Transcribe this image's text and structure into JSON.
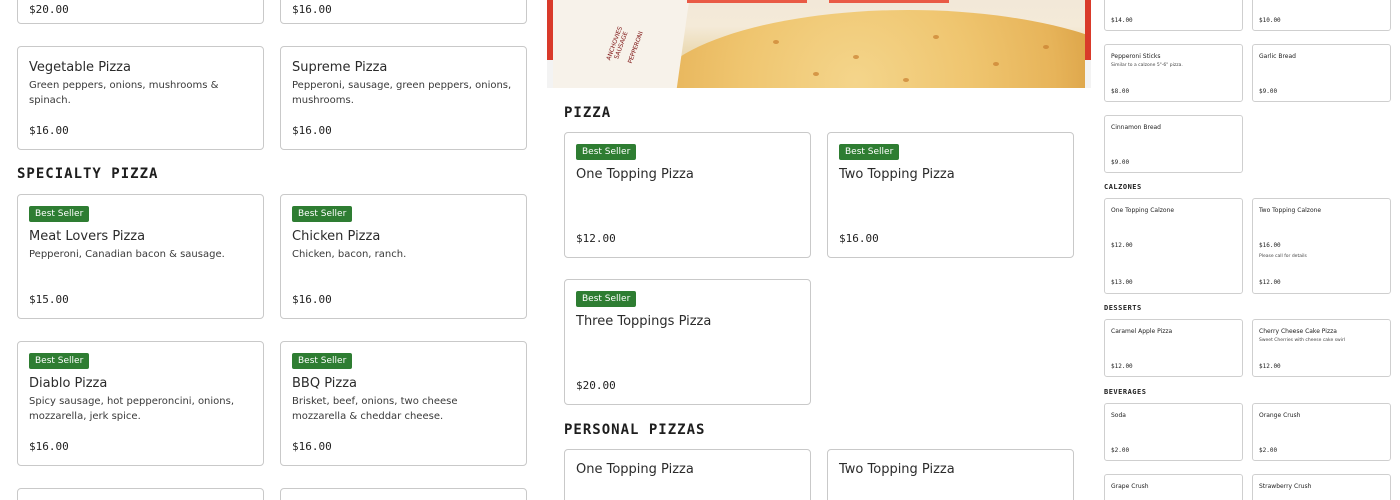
{
  "left": {
    "top_prices": [
      "$20.00",
      "$16.00"
    ],
    "row1": [
      {
        "name": "Vegetable Pizza",
        "desc": "Green peppers, onions, mushrooms & spinach.",
        "price": "$16.00"
      },
      {
        "name": "Supreme Pizza",
        "desc": "Pepperoni, sausage, green peppers, onions, mushrooms.",
        "price": "$16.00"
      }
    ],
    "specialty_title": "SPECIALTY PIZZA",
    "specialty": [
      {
        "badge": "Best Seller",
        "name": "Meat Lovers Pizza",
        "desc": "Pepperoni, Canadian bacon & sausage.",
        "price": "$15.00"
      },
      {
        "badge": "Best Seller",
        "name": "Chicken Pizza",
        "desc": "Chicken, bacon, ranch.",
        "price": "$16.00"
      },
      {
        "badge": "Best Seller",
        "name": "Diablo Pizza",
        "desc": "Spicy sausage, hot pepperoncini, onions, mozzarella, jerk spice.",
        "price": "$16.00"
      },
      {
        "badge": "Best Seller",
        "name": "BBQ Pizza",
        "desc": "Brisket, beef, onions, two cheese mozzarella & cheddar cheese.",
        "price": "$16.00"
      }
    ]
  },
  "hero": {
    "box_text": [
      "ANCHOVIES",
      "SAUSAGE",
      "PEPPERONI"
    ]
  },
  "middle": {
    "pizza_title": "PIZZA",
    "pizza": [
      {
        "badge": "Best Seller",
        "name": "One Topping Pizza",
        "price": "$12.00"
      },
      {
        "badge": "Best Seller",
        "name": "Two Topping Pizza",
        "price": "$16.00"
      },
      {
        "badge": "Best Seller",
        "name": "Three Toppings Pizza",
        "price": "$20.00"
      }
    ],
    "personal_title": "PERSONAL PIZZAS",
    "personal": [
      {
        "name": "One Topping Pizza"
      },
      {
        "name": "Two Topping Pizza"
      }
    ]
  },
  "right": {
    "top_prices": [
      "$14.00",
      "$10.00"
    ],
    "sides": [
      {
        "name": "Pepperoni Sticks",
        "desc": "Similar to a calzone 5\"-6\" pizza.",
        "price": "$8.00"
      },
      {
        "name": "Garlic Bread",
        "desc": "",
        "price": "$9.00"
      },
      {
        "name": "Cinnamon Bread",
        "desc": "",
        "price": "$9.00"
      }
    ],
    "calzones_title": "CALZONES",
    "calzones": [
      {
        "name": "One Topping Calzone",
        "price": "$12.00",
        "price2": "$13.00"
      },
      {
        "name": "Two Topping Calzone",
        "price": "$16.00",
        "note": "Please call for details",
        "price2": "$12.00"
      }
    ],
    "desserts_title": "DESSERTS",
    "desserts": [
      {
        "name": "Caramel Apple Pizza",
        "desc": "",
        "price": "$12.00"
      },
      {
        "name": "Cherry Cheese Cake Pizza",
        "desc": "Sweet Cherries with cheese cake swirl",
        "price": "$12.00"
      }
    ],
    "beverages_title": "BEVERAGES",
    "beverages": [
      {
        "name": "Soda",
        "price": "$2.00"
      },
      {
        "name": "Orange Crush",
        "price": "$2.00"
      },
      {
        "name": "Grape Crush"
      },
      {
        "name": "Strawberry Crush"
      }
    ]
  }
}
